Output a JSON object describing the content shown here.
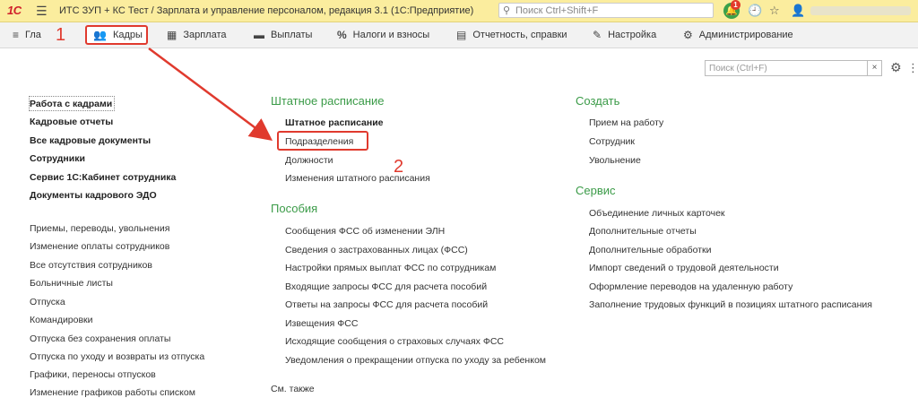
{
  "titlebar": {
    "logo": "1С",
    "title": "ИТС ЗУП + КС Тест / Зарплата и управление персоналом, редакция 3.1  (1С:Предприятие)",
    "search_placeholder": "Поиск Ctrl+Shift+F",
    "notification_count": "1"
  },
  "sections": [
    {
      "label": "Главное",
      "icon": "home-icon"
    },
    {
      "label": "Кадры",
      "icon": "people-icon"
    },
    {
      "label": "Зарплата",
      "icon": "calculator-icon"
    },
    {
      "label": "Выплаты",
      "icon": "wallet-icon"
    },
    {
      "label": "Налоги и взносы",
      "icon": "percent-icon"
    },
    {
      "label": "Отчетность, справки",
      "icon": "report-icon"
    },
    {
      "label": "Настройка",
      "icon": "wrench-icon"
    },
    {
      "label": "Администрирование",
      "icon": "gear-icon"
    }
  ],
  "content_search": {
    "placeholder": "Поиск (Ctrl+F)",
    "clear": "×"
  },
  "annotations": {
    "one": "1",
    "two": "2"
  },
  "left_column": {
    "main_links": [
      "Работа с кадрами",
      "Кадровые отчеты",
      "Все кадровые документы",
      "Сотрудники",
      "Сервис 1С:Кабинет сотрудника",
      "Документы кадрового ЭДО"
    ],
    "links": [
      "Приемы, переводы, увольнения",
      "Изменение оплаты сотрудников",
      "Все отсутствия сотрудников",
      "Больничные листы",
      "Отпуска",
      "Командировки",
      "Отпуска без сохранения оплаты",
      "Отпуска по уходу и возвраты из отпуска",
      "Графики, переносы отпусков",
      "Изменение графиков работы списком"
    ]
  },
  "middle_column": {
    "staff_heading": "Штатное расписание",
    "staff_links": [
      "Штатное расписание",
      "Подразделения",
      "Должности",
      "Изменения штатного расписания"
    ],
    "benefits_heading": "Пособия",
    "benefits_links": [
      "Сообщения ФСС об изменении ЭЛН",
      "Сведения о застрахованных лицах (ФСС)",
      "Настройки прямых выплат ФСС по сотрудникам",
      "Входящие запросы ФСС для расчета пособий",
      "Ответы на запросы ФСС для расчета пособий",
      "Извещения ФСС",
      "Исходящие сообщения о страховых случаях ФСС",
      "Уведомления о прекращении отпуска по уходу за ребенком"
    ],
    "see_also": "См. также"
  },
  "right_column": {
    "create_heading": "Создать",
    "create_links": [
      "Прием на работу",
      "Сотрудник",
      "Увольнение"
    ],
    "service_heading": "Сервис",
    "service_links": [
      "Объединение личных карточек",
      "Дополнительные отчеты",
      "Дополнительные обработки",
      "Импорт сведений о трудовой деятельности",
      "Оформление переводов на удаленную работу",
      "Заполнение трудовых функций в позициях штатного расписания"
    ]
  },
  "colors": {
    "accent_green": "#3b9b48",
    "annotation_red": "#e03a2e",
    "titlebar_yellow": "#fbed9e"
  }
}
